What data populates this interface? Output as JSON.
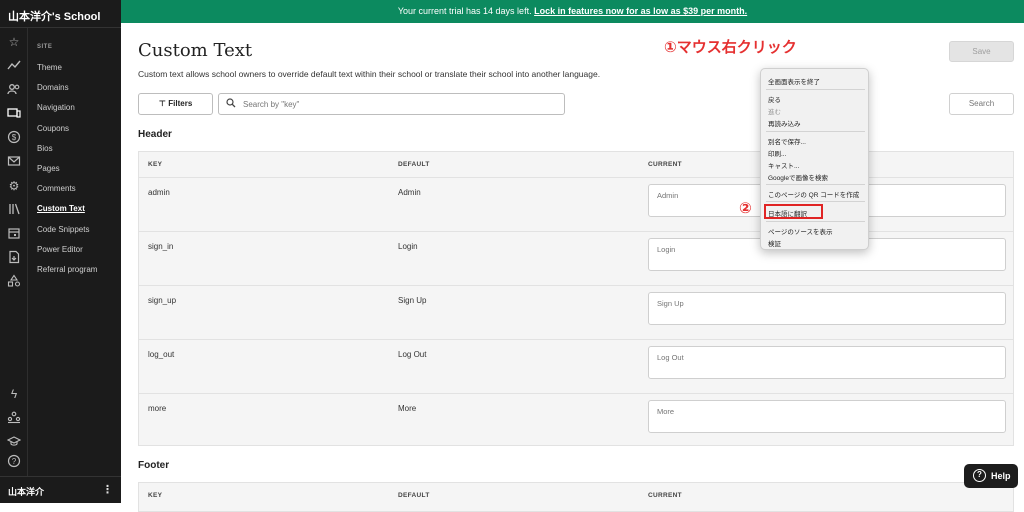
{
  "school_name": "山本洋介's School",
  "banner": {
    "text": "Your current trial has 14 days left.",
    "link": "Lock in features now for as low as $39 per month."
  },
  "sidebar": {
    "section": "SITE",
    "items": [
      "Theme",
      "Domains",
      "Navigation",
      "Coupons",
      "Bios",
      "Pages",
      "Comments",
      "Custom Text",
      "Code Snippets",
      "Power Editor",
      "Referral program"
    ],
    "active": "Custom Text"
  },
  "user_name": "山本洋介",
  "page": {
    "title": "Custom Text",
    "description": "Custom text allows school owners to override default text within their school or translate their school into another language.",
    "save_label": "Save",
    "filters_label": "Filters",
    "search_placeholder": "Search by \"key\"",
    "search_button": "Search"
  },
  "table_headers": {
    "key": "KEY",
    "default": "DEFAULT",
    "current": "CURRENT"
  },
  "header_section": {
    "title": "Header",
    "rows": [
      {
        "key": "admin",
        "default": "Admin",
        "placeholder": "Admin"
      },
      {
        "key": "sign_in",
        "default": "Login",
        "placeholder": "Login"
      },
      {
        "key": "sign_up",
        "default": "Sign Up",
        "placeholder": "Sign Up"
      },
      {
        "key": "log_out",
        "default": "Log Out",
        "placeholder": "Log Out"
      },
      {
        "key": "more",
        "default": "More",
        "placeholder": "More"
      }
    ]
  },
  "footer_section": {
    "title": "Footer"
  },
  "context_menu": {
    "items": [
      "全画面表示を終了",
      "戻る",
      "進む",
      "再読み込み",
      "別名で保存...",
      "印刷...",
      "キャスト...",
      "Googleで画像を検索",
      "このページの QR コードを作成",
      "日本語に翻訳",
      "ページのソースを表示",
      "検証"
    ]
  },
  "annotations": {
    "step1": "①マウス右クリック",
    "step2": "②"
  },
  "help_label": "Help",
  "colors": {
    "banner": "#0c8a5f",
    "sidebar": "#1b1b1b",
    "annotation": "#e53030"
  }
}
